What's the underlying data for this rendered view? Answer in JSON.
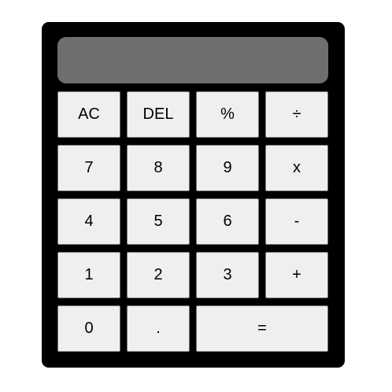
{
  "display": {
    "value": ""
  },
  "keys": {
    "ac": "AC",
    "del": "DEL",
    "percent": "%",
    "divide": "÷",
    "seven": "7",
    "eight": "8",
    "nine": "9",
    "multiply": "x",
    "four": "4",
    "five": "5",
    "six": "6",
    "subtract": "-",
    "one": "1",
    "two": "2",
    "three": "3",
    "add": "+",
    "zero": "0",
    "decimal": ".",
    "equals": "="
  },
  "colors": {
    "body": "#000000",
    "display": "#6e6e6e",
    "key": "#efefef",
    "key_border": "#767676"
  }
}
